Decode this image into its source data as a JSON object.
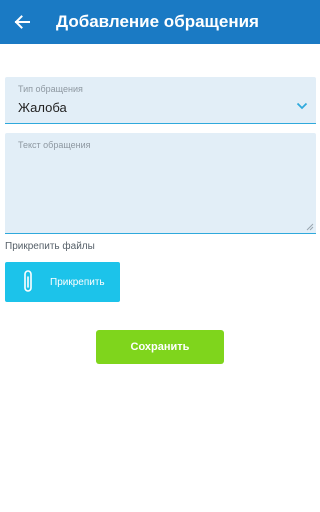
{
  "header": {
    "title": "Добавление обращения",
    "back_icon": "arrow-left-icon"
  },
  "form": {
    "type_field": {
      "label": "Тип обращения",
      "value": "Жалоба",
      "icon": "chevron-down-icon"
    },
    "text_field": {
      "label": "Текст обращения",
      "value": ""
    },
    "attach_label": "Прикрепить файлы",
    "attach_button": {
      "label": "Прикрепить",
      "icon": "paperclip-icon"
    },
    "save_button": {
      "label": "Сохранить"
    }
  },
  "colors": {
    "appbar": "#1a7ac4",
    "field_background": "#e2eef7",
    "accent": "#2fa9dc",
    "attach_button": "#1cc3ea",
    "save_button": "#7fd51c"
  }
}
